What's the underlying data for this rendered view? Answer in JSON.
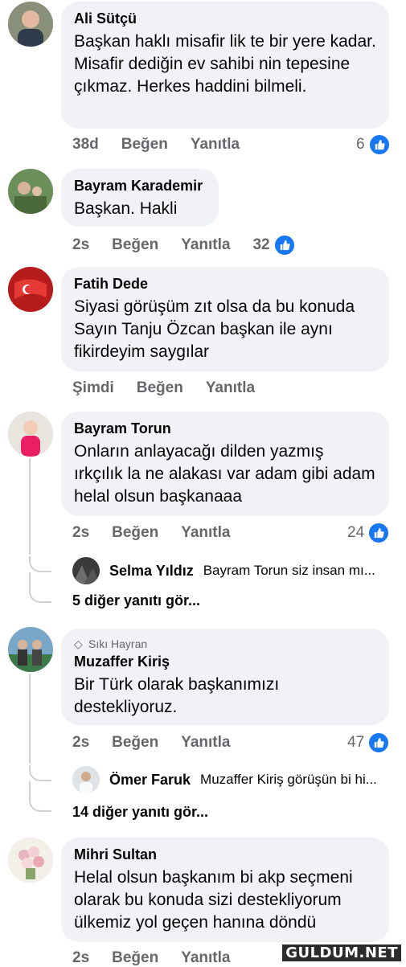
{
  "comments": [
    {
      "name": "Ali Sütçü",
      "text": "Başkan haklı misafir lik te bir yere kadar. Misafir dediğin ev sahibi nin tepesine çıkmaz. Herkes haddini bilmeli.",
      "time": "38d",
      "like_label": "Beğen",
      "reply_label": "Yanıtla",
      "likes": "6"
    },
    {
      "name": "Bayram Karademir",
      "text": "Başkan. Hakli",
      "time": "2s",
      "like_label": "Beğen",
      "reply_label": "Yanıtla",
      "likes": "32"
    },
    {
      "name": "Fatih Dede",
      "text": "Siyasi görüşüm zıt olsa da bu konuda Sayın Tanju Özcan başkan ile aynı fikirdeyim saygılar",
      "time": "Şimdi",
      "like_label": "Beğen",
      "reply_label": "Yanıtla"
    },
    {
      "name": "Bayram Torun",
      "text": "Onların anlayacağı dilden yazmış ırkçılık la ne alakası var adam gibi adam helal olsun başkanaaa",
      "time": "2s",
      "like_label": "Beğen",
      "reply_label": "Yanıtla",
      "likes": "24",
      "reply": {
        "name": "Selma Yıldız",
        "text": "Bayram Torun siz insan mı..."
      },
      "more_replies": "5 diğer yanıtı gör..."
    },
    {
      "badge": "Sıkı Hayran",
      "name": "Muzaffer Kiriş",
      "text": "Bir Türk olarak başkanımızı destekliyoruz.",
      "time": "2s",
      "like_label": "Beğen",
      "reply_label": "Yanıtla",
      "likes": "47",
      "reply": {
        "name": "Ömer Faruk",
        "text": "Muzaffer Kiriş görüşün bi hi..."
      },
      "more_replies": "14 diğer yanıtı gör..."
    },
    {
      "name": "Mihri Sultan",
      "text": "Helal olsun başkanım bi akp seçmeni olarak bu konuda sizi destekliyorum ülkemiz yol geçen hanına döndü",
      "time": "2s",
      "like_label": "Beğen",
      "reply_label": "Yanıtla"
    }
  ],
  "watermark": "GULDUM.NET",
  "colors": {
    "like_blue": "#1877f2",
    "bubble": "#f0f2f5",
    "meta": "#65676b"
  },
  "icons": {
    "like": "thumbs-up-icon",
    "badge": "diamond-icon"
  }
}
